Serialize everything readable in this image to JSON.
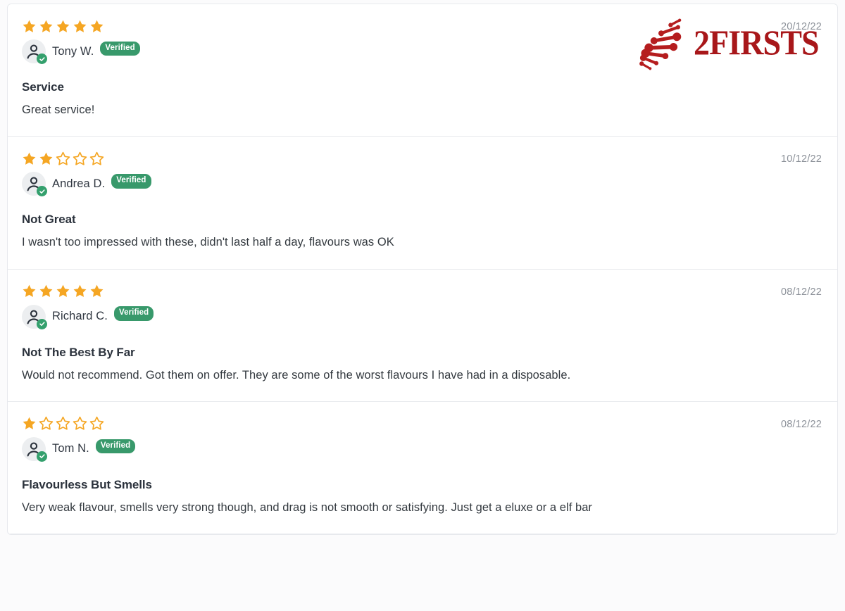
{
  "brand": {
    "logo_text": "2FIRSTS",
    "logo_mark_name": "dna-helix-mark",
    "logo_color": "#a8171a"
  },
  "colors": {
    "star_filled": "#f5a623",
    "star_empty_outline": "#f5a623",
    "verified_badge_bg": "#38996b",
    "avatar_check_bg": "#34a06d",
    "card_border": "#e7e9ed",
    "text_primary": "#2b323c",
    "text_body": "#33393f",
    "text_muted": "#8c9199",
    "page_bg": "#fbfbfc"
  },
  "verified_label": "Verified",
  "reviews": [
    {
      "rating": 5,
      "max_rating": 5,
      "name": "Tony W.",
      "verified": "Verified",
      "date": "20/12/22",
      "title": "Service",
      "body": "Great service!"
    },
    {
      "rating": 2,
      "max_rating": 5,
      "name": "Andrea D.",
      "verified": "Verified",
      "date": "10/12/22",
      "title": "Not Great",
      "body": "I wasn't too impressed with these, didn't last half a day, flavours was OK"
    },
    {
      "rating": 5,
      "max_rating": 5,
      "name": "Richard C.",
      "verified": "Verified",
      "date": "08/12/22",
      "title": "Not The Best By Far",
      "body": "Would not recommend. Got them on offer. They are some of the worst flavours I have had in a disposable."
    },
    {
      "rating": 1,
      "max_rating": 5,
      "name": "Tom N.",
      "verified": "Verified",
      "date": "08/12/22",
      "title": "Flavourless But Smells",
      "body": "Very weak flavour, smells very strong though, and drag is not smooth or satisfying. Just get a eluxe or a elf bar"
    }
  ]
}
